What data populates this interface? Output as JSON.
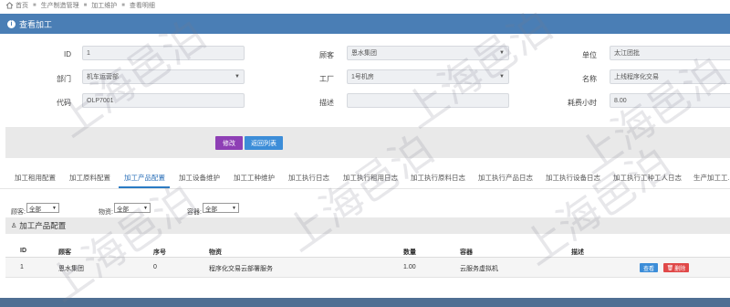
{
  "breadcrumb": {
    "items": [
      "首页",
      "生产制造管理",
      "加工维护",
      "查看明细"
    ]
  },
  "panel": {
    "title": "查看加工"
  },
  "form": {
    "id_label": "ID",
    "id_value": "1",
    "customer_label": "顾客",
    "customer_value": "恩水集团",
    "unit_label": "单位",
    "unit_value": "太江团批",
    "dept_label": "部门",
    "dept_value": "机车运营部",
    "factory_label": "工厂",
    "factory_value": "1号机房",
    "name_label": "名称",
    "name_value": "上线程序化交易",
    "code_label": "代码",
    "code_value": "OLP7001",
    "desc_label": "描述",
    "desc_value": "",
    "hours_label": "耗费小时",
    "hours_value": "8.00"
  },
  "actions": {
    "edit_label": "修改",
    "back_label": "返回列表"
  },
  "tabs": [
    "加工租用配置",
    "加工原料配置",
    "加工产品配置",
    "加工设备维护",
    "加工工种维护",
    "加工执行日志",
    "加工执行租用日志",
    "加工执行原料日志",
    "加工执行产品日志",
    "加工执行设备日志",
    "加工执行工种工人日志",
    "生产加工工..."
  ],
  "active_tab": 2,
  "filters": {
    "customer_label": "顾客:",
    "customer_value": "全部",
    "material_label": "物资:",
    "material_value": "全部",
    "container_label": "容器:",
    "container_value": "全部"
  },
  "section": {
    "title": "加工产品配置"
  },
  "table": {
    "headers": [
      "ID",
      "顾客",
      "序号",
      "物资",
      "数量",
      "容器",
      "描述"
    ],
    "rows": [
      {
        "id": "1",
        "customer": "恩水集团",
        "seq": "0",
        "material": "程序化交易云部署服务",
        "qty": "1.00",
        "container": "云服务虚拟机",
        "desc": ""
      }
    ],
    "view_label": "查看",
    "delete_label": "删除"
  },
  "watermark": "上海邑泊",
  "colors": {
    "header": "#4a7eb5",
    "edit_btn": "#8e3fb5",
    "back_btn": "#3c8dd8",
    "delete_btn": "#e04848"
  }
}
